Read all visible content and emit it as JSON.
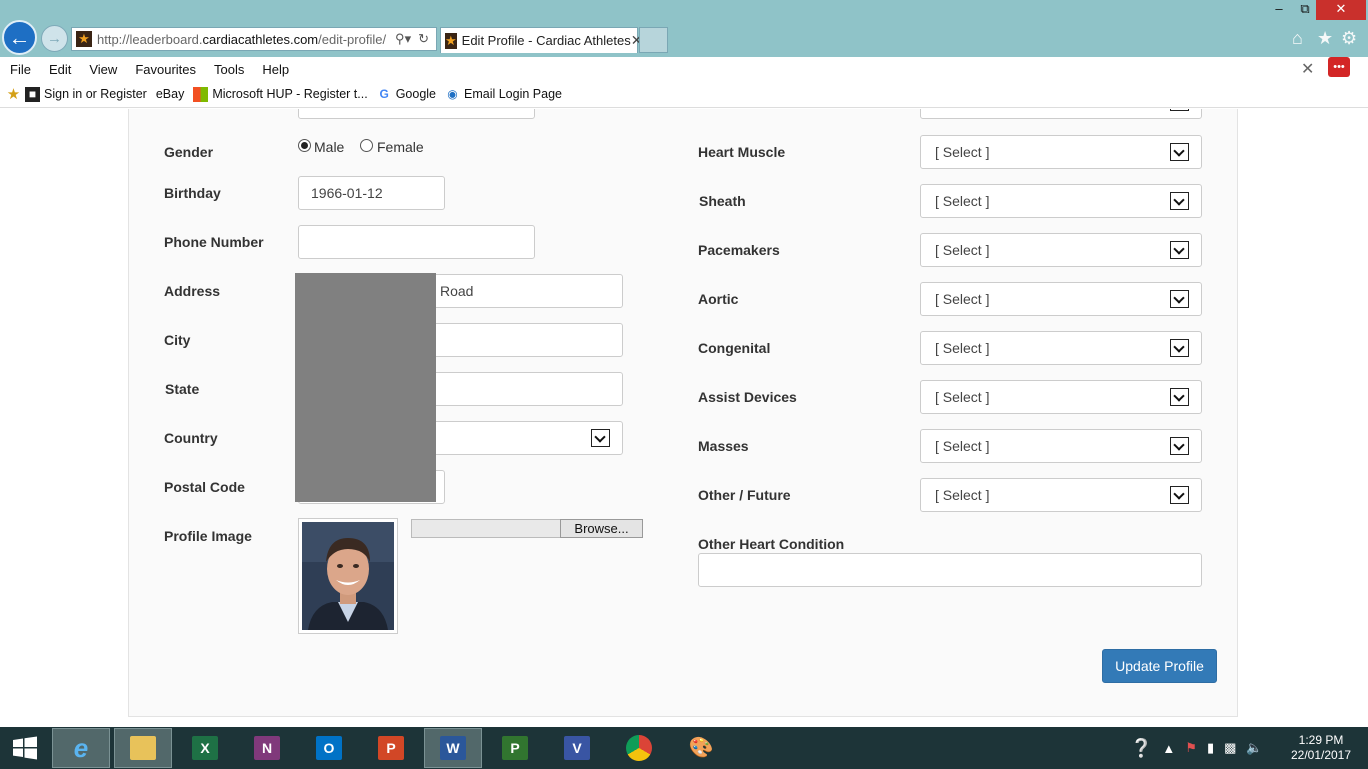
{
  "browser": {
    "url_prefix": "http://leaderboard.",
    "url_domain": "cardiacathletes.com",
    "url_path": "/edit-profile/",
    "tab_title": "Edit Profile - Cardiac Athletes",
    "menu": [
      "File",
      "Edit",
      "View",
      "Favourites",
      "Tools",
      "Help"
    ],
    "favourites": [
      "Sign in or Register",
      "eBay",
      "Microsoft HUP - Register t...",
      "Google",
      "Email Login Page"
    ]
  },
  "form_left": {
    "gender_label": "Gender",
    "gender_options": [
      "Male",
      "Female"
    ],
    "gender_selected": "Male",
    "birthday_label": "Birthday",
    "birthday_value": "1966-01-12",
    "phone_label": "Phone Number",
    "phone_value": "",
    "address_label": "Address",
    "address_value": "Road",
    "city_label": "City",
    "state_label": "State",
    "country_label": "Country",
    "postal_label": "Postal Code",
    "profile_image_label": "Profile Image",
    "browse_label": "Browse..."
  },
  "form_right": {
    "conditions": [
      {
        "label": "Heart Muscle",
        "value": "[ Select ]"
      },
      {
        "label": "Sheath",
        "value": "[ Select ]"
      },
      {
        "label": "Pacemakers",
        "value": "[ Select ]"
      },
      {
        "label": "Aortic",
        "value": "[ Select ]"
      },
      {
        "label": "Congenital",
        "value": "[ Select ]"
      },
      {
        "label": "Assist Devices",
        "value": "[ Select ]"
      },
      {
        "label": "Masses",
        "value": "[ Select ]"
      },
      {
        "label": "Other / Future",
        "value": "[ Select ]"
      }
    ],
    "other_label": "Other Heart Condition",
    "other_value": ""
  },
  "update_button": "Update Profile",
  "taskbar": {
    "time": "1:29 PM",
    "date": "22/01/2017",
    "apps": [
      "windows-start",
      "internet-explorer",
      "file-explorer",
      "excel",
      "onenote",
      "outlook",
      "powerpoint",
      "word",
      "project",
      "visio",
      "chrome",
      "paint"
    ]
  },
  "colors": {
    "accent": "#337ab7",
    "chrome": "#8fc3c8",
    "taskbar": "#1d3438"
  }
}
